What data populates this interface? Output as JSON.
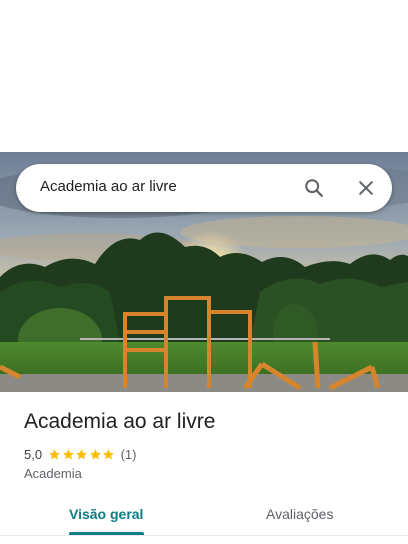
{
  "search": {
    "query": "Academia ao ar livre",
    "search_icon": "search-icon",
    "close_icon": "close-icon"
  },
  "hero_image": {
    "description_icon": "outdoor-gym-photo"
  },
  "place": {
    "name": "Academia ao ar livre",
    "rating": "5,0",
    "stars": 5,
    "review_count": "(1)",
    "category": "Academia"
  },
  "tabs": [
    {
      "label": "Visão geral",
      "selected": true
    },
    {
      "label": "Avaliações",
      "selected": false
    }
  ],
  "colors": {
    "accent": "#137d85",
    "star": "#fbbc04",
    "text_primary": "#202124",
    "text_secondary": "#5f6368"
  }
}
